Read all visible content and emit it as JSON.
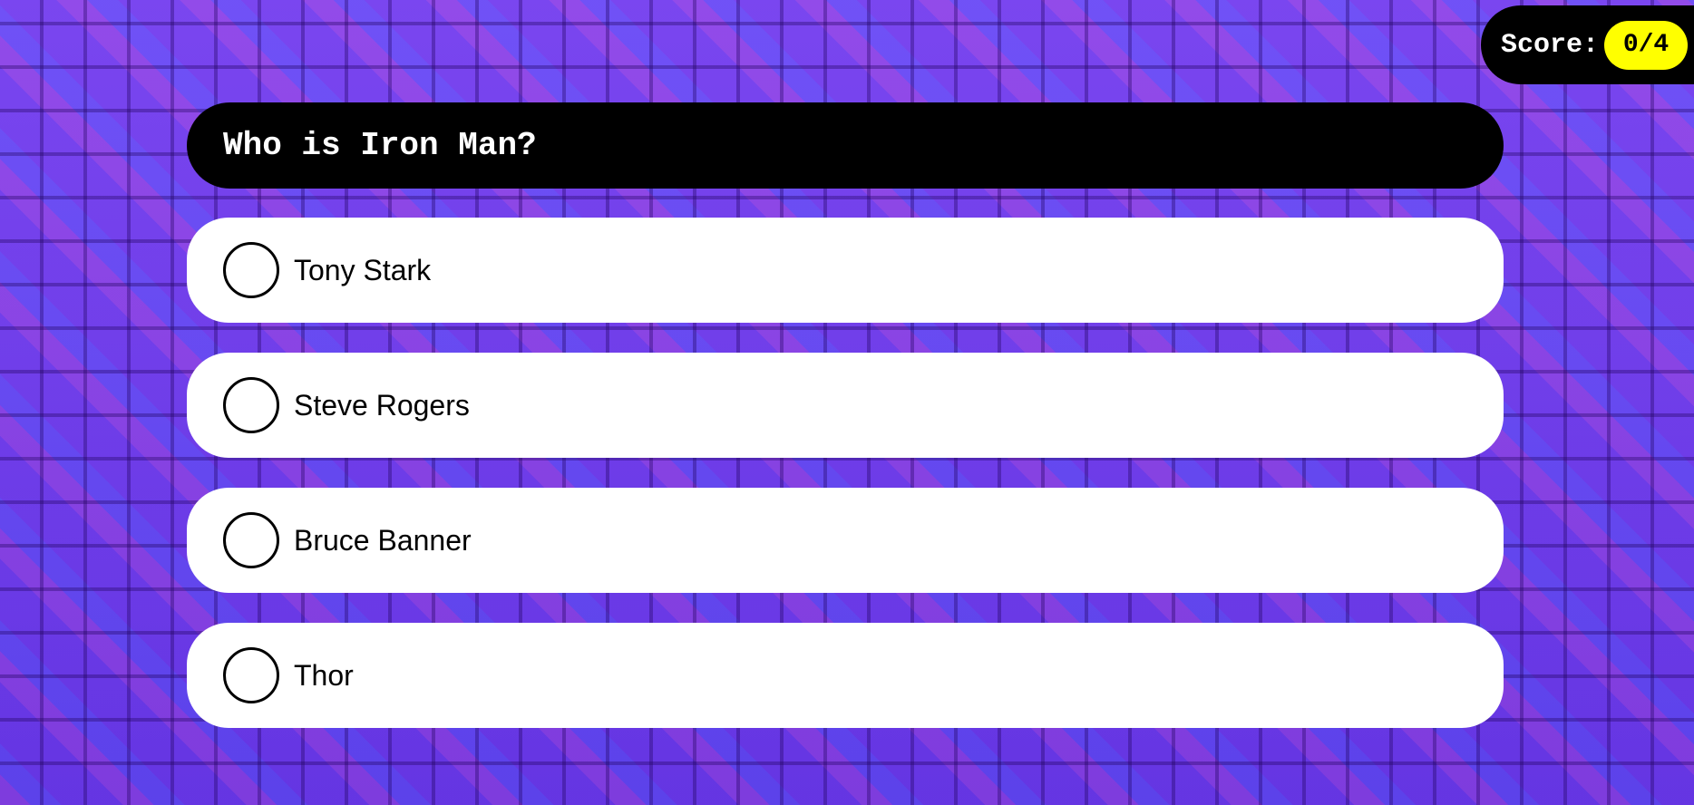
{
  "colors": {
    "background": "#6a3df0",
    "pill_black": "#000000",
    "score_badge": "#ffff00",
    "option_bg": "#ffffff"
  },
  "score": {
    "label": "Score:",
    "value": "0/4"
  },
  "question": {
    "text": "Who is Iron Man?"
  },
  "options": [
    {
      "label": "Tony Stark",
      "icon": "radio-unchecked-icon"
    },
    {
      "label": "Steve Rogers",
      "icon": "radio-unchecked-icon"
    },
    {
      "label": "Bruce Banner",
      "icon": "radio-unchecked-icon"
    },
    {
      "label": "Thor",
      "icon": "radio-unchecked-icon"
    }
  ]
}
